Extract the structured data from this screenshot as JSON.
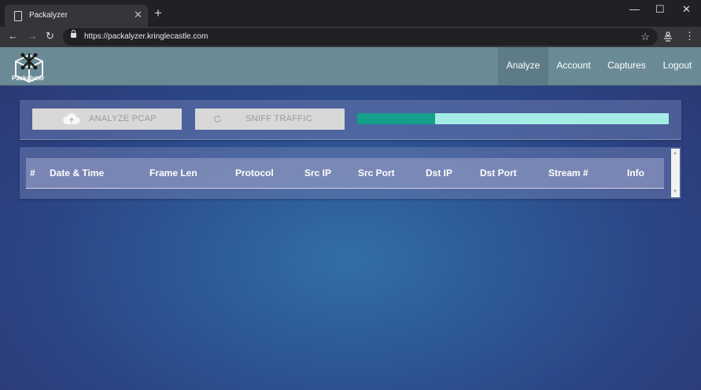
{
  "browser": {
    "tab_title": "Packalyzer",
    "url": "https://packalyzer.kringlecastle.com",
    "new_tab": "+",
    "close_tab": "✕",
    "minimize": "—",
    "maximize": "☐",
    "close": "✕",
    "back": "←",
    "forward": "→",
    "reload": "↻",
    "bookmark": "☆",
    "menu": "⋮"
  },
  "app": {
    "logo_text": "Packalyzer",
    "nav": {
      "analyze": "Analyze",
      "account": "Account",
      "captures": "Captures",
      "logout": "Logout"
    }
  },
  "controls": {
    "analyze_pcap_label": "ANALYZE PCAP",
    "analyze_pcap_icon": "cloud-upload-icon",
    "sniff_traffic_label": "SNIFF TRAFFIC",
    "sniff_traffic_icon": "refresh-icon",
    "progress_fraction": 0.25
  },
  "table": {
    "headers": {
      "num": "#",
      "datetime": "Date & Time",
      "framelen": "Frame Len",
      "protocol": "Protocol",
      "srcip": "Src IP",
      "srcport": "Src Port",
      "dstip": "Dst IP",
      "dstport": "Dst Port",
      "stream": "Stream #",
      "info": "Info"
    },
    "rows": []
  },
  "colors": {
    "navbar": "#6a8b96",
    "progress_fill": "#14a08a",
    "progress_track": "#a4ede6"
  }
}
